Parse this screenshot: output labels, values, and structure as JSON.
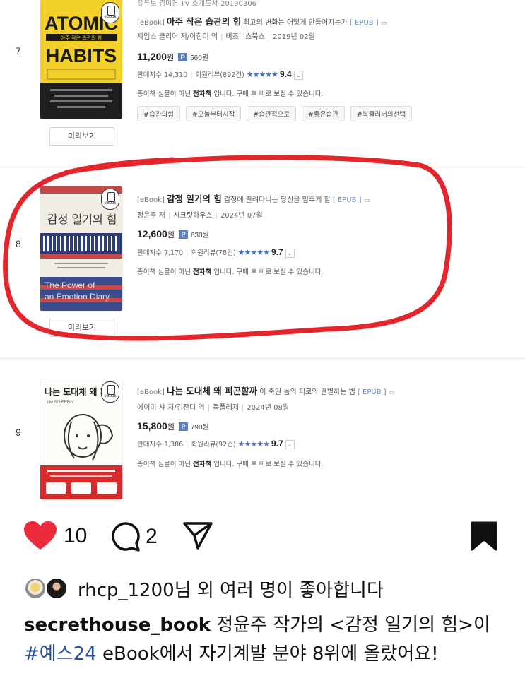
{
  "books": [
    {
      "rank": "7",
      "top_cut_text": "유튜브 김미경 TV 소개도서-20190306",
      "tag": "[eBook]",
      "title": "아주 작은 습관의 힘",
      "subtitle": "최고의 변화는 어떻게 만들어지는가",
      "format": "[ EPUB ]",
      "author": "제임스 클리어 저/이한이 역",
      "publisher": "비즈니스북스",
      "date": "2019년 02월",
      "price": "11,200",
      "won": "원",
      "point_badge": "P",
      "points": "560원",
      "sales_label": "판매지수 14,310",
      "reviews": "회원리뷰(892건)",
      "stars": "★★★★★",
      "score": "9.4",
      "note_prefix": "종이책 실물이 아닌",
      "note_bold": "전자책",
      "note_suffix": "입니다. 구매 후 바로 보실 수 있습니다.",
      "tags": [
        "#습관의힘",
        "#오늘부터시작",
        "#습관적으로",
        "#좋은습관",
        "#북클러버의선택"
      ],
      "cover_text": {
        "line1": "ATOMIC",
        "line2": "HABITS",
        "band": "아주 작은 습관의 힘"
      },
      "preview": "미리보기"
    },
    {
      "rank": "8",
      "tag": "[eBook]",
      "title": "감정 일기의 힘",
      "subtitle": "감정에 끌려다니는 당신을 멈추게 할",
      "format": "[ EPUB ]",
      "author": "정윤주 저",
      "publisher": "시크릿하우스",
      "date": "2024년 07월",
      "price": "12,600",
      "won": "원",
      "point_badge": "P",
      "points": "630원",
      "sales_label": "판매지수 7,170",
      "reviews": "회원리뷰(78건)",
      "stars": "★★★★★",
      "score": "9.7",
      "note_prefix": "종이책 실물이 아닌",
      "note_bold": "전자책",
      "note_suffix": "입니다. 구매 후 바로 보실 수 있습니다.",
      "cover_text": {
        "title": "감정 일기의 힘",
        "en1": "The Power of",
        "en2": "an Emotion Diary"
      },
      "preview": "미리보기"
    },
    {
      "rank": "9",
      "tag": "[eBook]",
      "title": "나는 도대체 왜 피곤할까",
      "subtitle": "이 죽일 놈의 피로와 결별하는 법",
      "format": "[ EPUB ]",
      "author": "에이미 샤 저/김잔디 역",
      "publisher": "북플레저",
      "date": "2024년 08월",
      "price": "15,800",
      "won": "원",
      "point_badge": "P",
      "points": "790원",
      "sales_label": "판매지수 1,386",
      "reviews": "회원리뷰(92건)",
      "stars": "★★★★★",
      "score": "9.7",
      "note_prefix": "종이책 실물이 아닌",
      "note_bold": "전자책",
      "note_suffix": "입니다. 구매 후 바로 보실 수 있습니다.",
      "cover_text": {
        "title": "나는 도대체 왜 피",
        "en": "I'M SO EFFIN'"
      }
    }
  ],
  "ebook_badge": "eBook",
  "instagram": {
    "like_count": "10",
    "comment_count": "2",
    "liked_by_user": "rhcp_1200",
    "liked_by_suffix": "님 외 여러 명이 좋아합니다",
    "caption_author": "secrethouse_book",
    "caption_part1": "정윤주 작가의 <감정 일기의 힘>이",
    "caption_hashtag": "#예스24",
    "caption_part2": "eBook에서 자기계발 분야 8위에 올랐어요!"
  },
  "colors": {
    "heart": "#ed2b3c",
    "highlight": "#e3262b",
    "star": "#4a6fbf",
    "hashtag": "#2a4f9f"
  }
}
